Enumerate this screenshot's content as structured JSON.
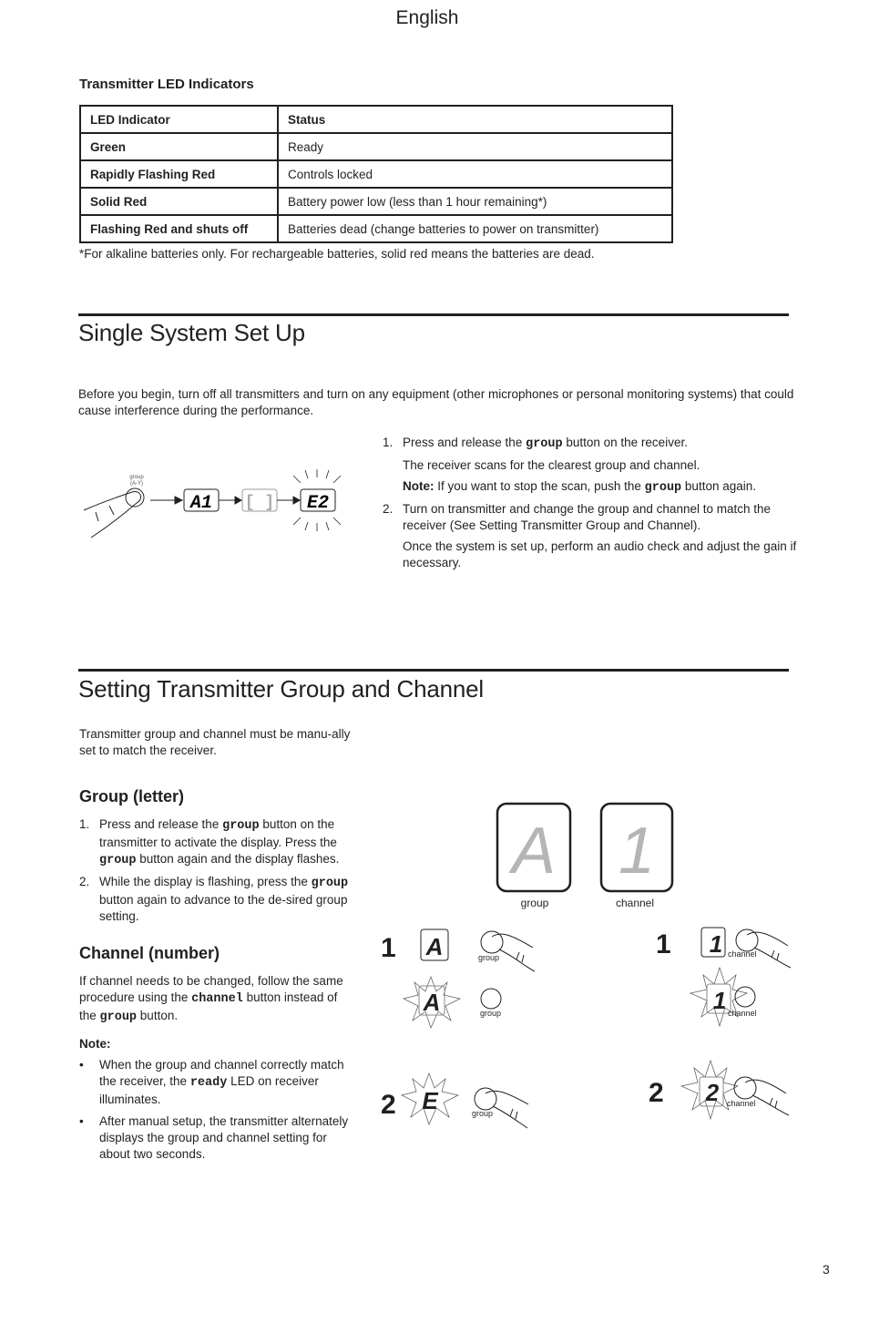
{
  "header": {
    "language": "English"
  },
  "led_section": {
    "title": "Transmitter LED Indicators",
    "table": {
      "headers": [
        "LED Indicator",
        "Status"
      ],
      "rows": [
        [
          "Green",
          "Ready"
        ],
        [
          "Rapidly Flashing Red",
          "Controls locked"
        ],
        [
          "Solid Red",
          "Battery power low (less than 1 hour remaining*)"
        ],
        [
          "Flashing Red and shuts off",
          "Batteries dead (change batteries to power on transmitter)"
        ]
      ]
    },
    "footnote": "*For alkaline batteries only. For rechargeable batteries, solid red means the batteries are dead."
  },
  "single_setup": {
    "title": "Single System Set Up",
    "intro": "Before you begin, turn off all transmitters and turn on any equipment (other microphones or personal monitoring systems) that could cause interference during the performance.",
    "figure": {
      "button_label": "group",
      "button_sublabel": "(A-Y)",
      "displays": [
        "A1",
        "[ ]",
        "E2"
      ]
    },
    "steps": [
      {
        "num": "1.",
        "pre": "Press and release the ",
        "code": "group",
        "post": " button on the receiver.",
        "sub1": "The receiver scans for the clearest group and channel.",
        "note_label": "Note:",
        "note_pre": " If you want to stop the scan, push the ",
        "note_code": "group",
        "note_post": " button again."
      },
      {
        "num": "2.",
        "text": "Turn on transmitter and change the group and channel to match the receiver (See Setting Transmitter Group and Channel).",
        "sub1": "Once the system is set up, perform an audio check and adjust the gain if necessary."
      }
    ]
  },
  "transmitter_setting": {
    "title": "Setting Transmitter Group and Channel",
    "intro": "Transmitter group and channel must be manu-ally set to match the receiver.",
    "group": {
      "title": "Group (letter)",
      "steps": [
        {
          "num": "1.",
          "pre": "Press and release the ",
          "code1": "group",
          "mid": " button on the transmitter to activate the display. Press the ",
          "code2": "group",
          "post": " button again and the display flashes."
        },
        {
          "num": "2.",
          "pre": "While the display is flashing, press the ",
          "code1": "group",
          "post": " button again to advance to the de-sired group setting."
        }
      ]
    },
    "channel": {
      "title": "Channel (number)",
      "pre": "If channel needs to be changed, follow the same procedure using the ",
      "code1": "channel",
      "mid": " button instead of the ",
      "code2": "group",
      "post": " button."
    },
    "note": {
      "label": "Note:",
      "items": [
        {
          "bullet": "•",
          "pre": "When the group and channel correctly match the receiver, the ",
          "code": "ready",
          "post": " LED on receiver illuminates."
        },
        {
          "bullet": "•",
          "text": "After manual setup, the transmitter alternately displays the group and channel setting for about two seconds."
        }
      ]
    },
    "figure": {
      "display_group_value": "A",
      "display_channel_value": "1",
      "group_label": "group",
      "channel_label": "channel",
      "group_steps": [
        {
          "num": "1",
          "display": "A",
          "button": "group",
          "flash_display": "A",
          "flash_button": "group"
        },
        {
          "num": "2",
          "display": "E",
          "button": "group"
        }
      ],
      "channel_steps": [
        {
          "num": "1",
          "display": "1",
          "button": "channel",
          "flash_display": "1",
          "flash_button": "channel"
        },
        {
          "num": "2",
          "display": "2",
          "button": "channel"
        }
      ]
    }
  },
  "page_number": "3"
}
